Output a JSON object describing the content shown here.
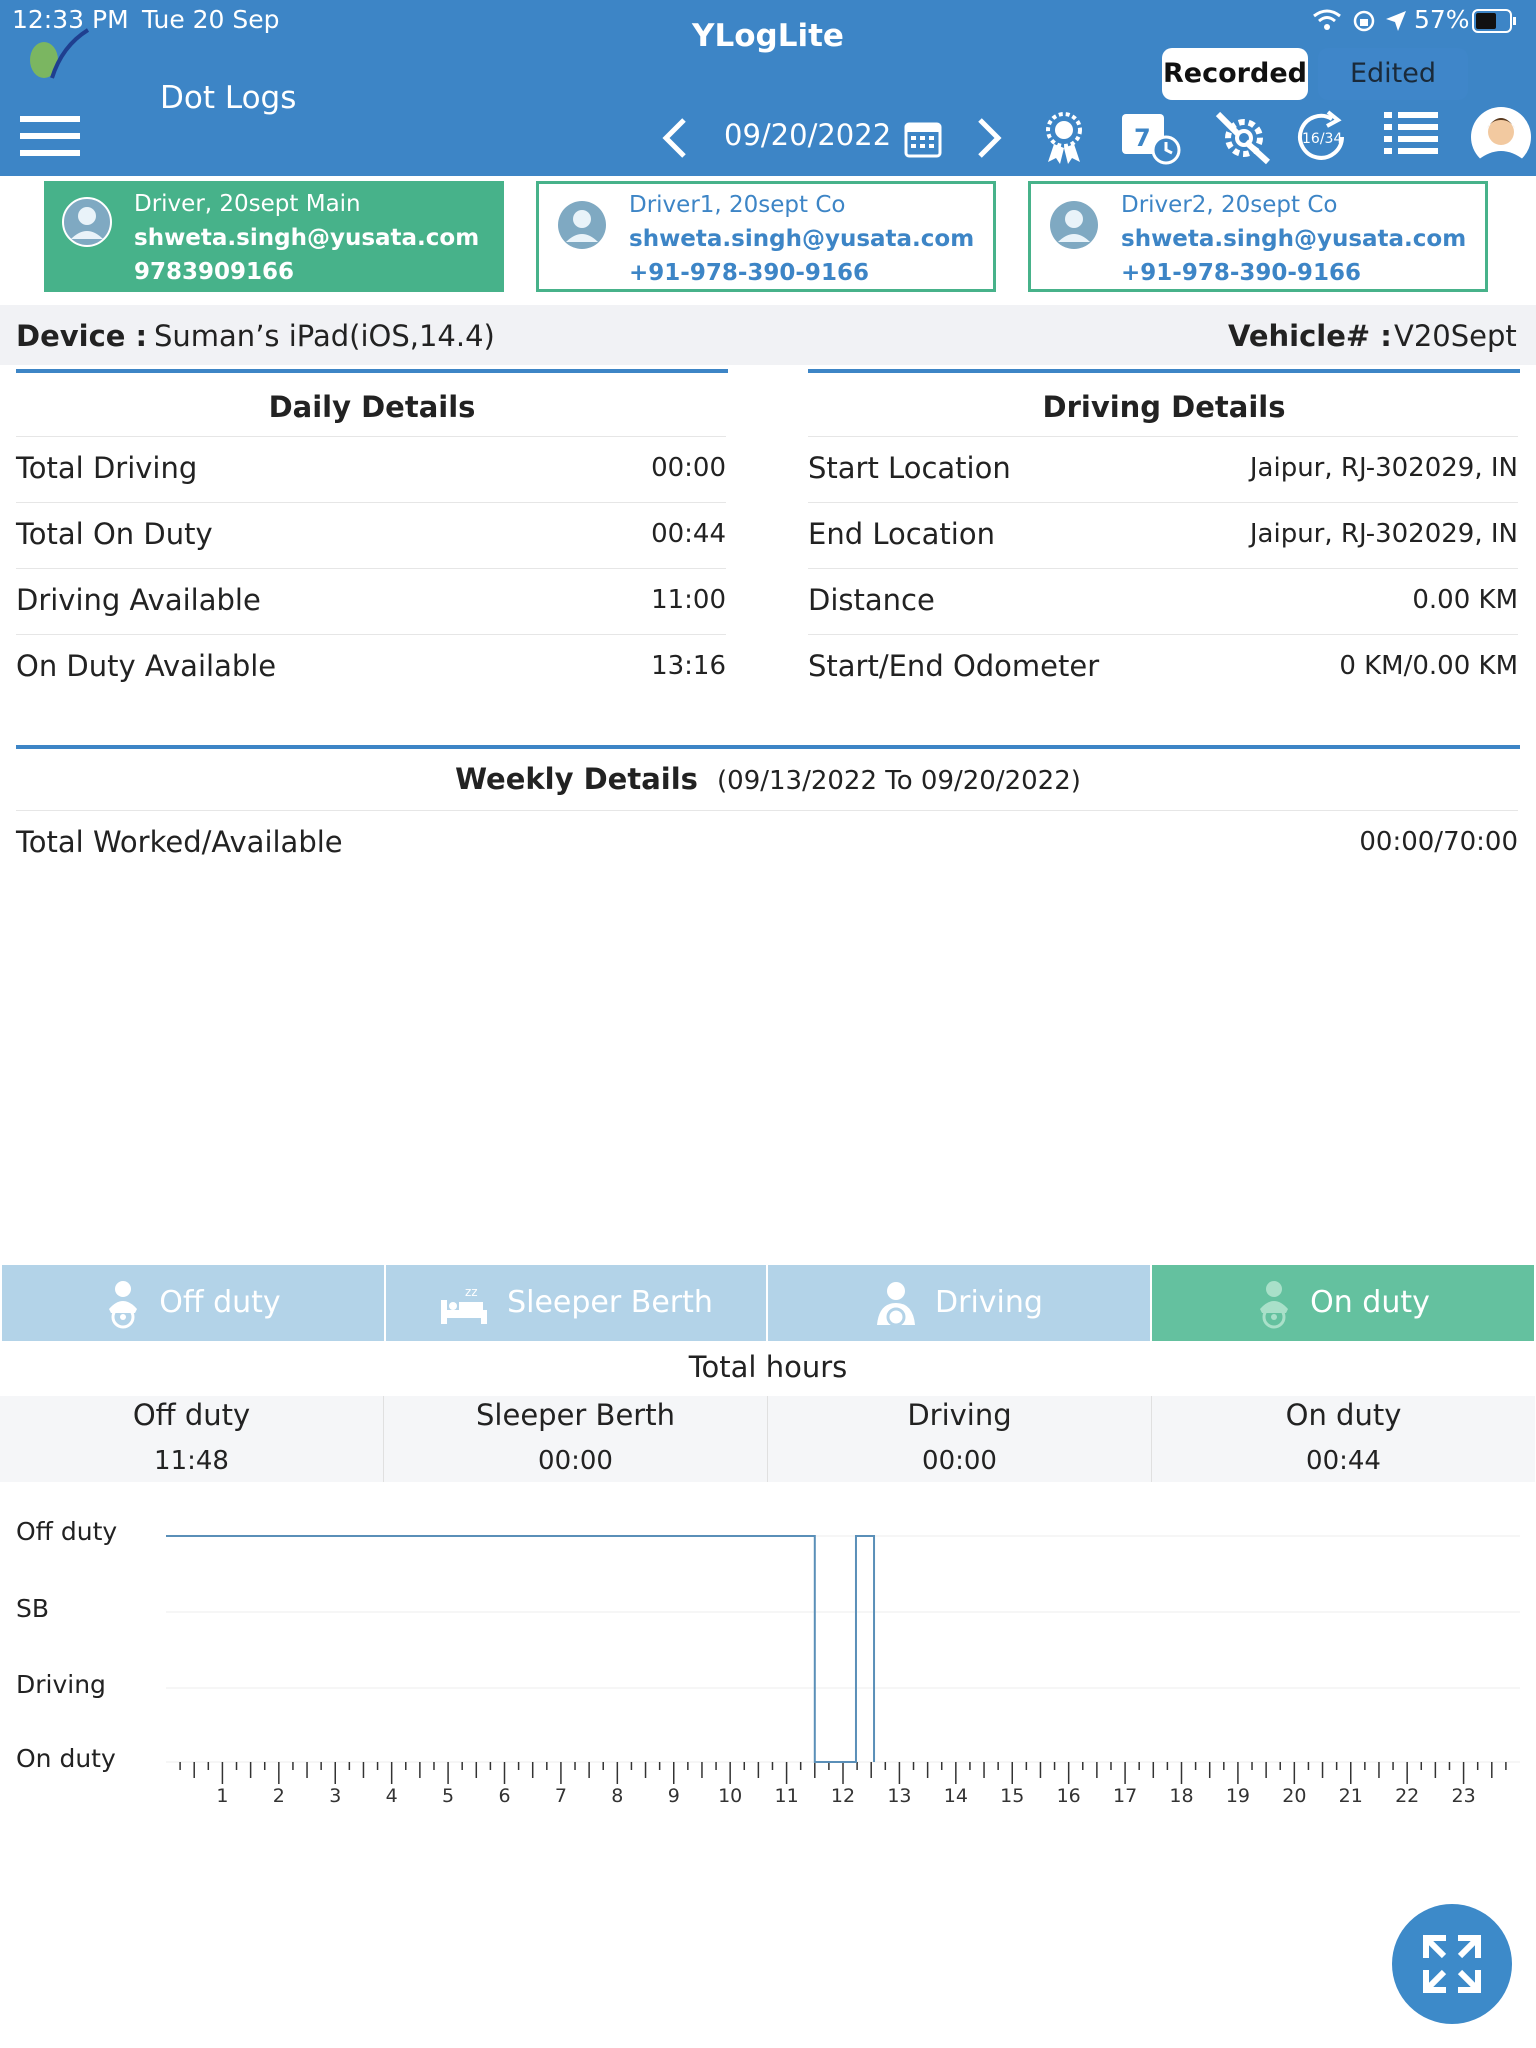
{
  "status_bar": {
    "time": "12:33 PM",
    "date": "Tue 20 Sep",
    "battery": "57%"
  },
  "header": {
    "app_title": "YLogLite",
    "screen_title": "Dot Logs",
    "segment_recorded": "Recorded",
    "segment_edited": "Edited",
    "date": "09/20/2022",
    "cycle_badge": "16/34"
  },
  "drivers": [
    {
      "name": "Driver, 20sept Main",
      "email": "shweta.singh@yusata.com",
      "phone": "9783909166"
    },
    {
      "name": "Driver1, 20sept Co",
      "email": "shweta.singh@yusata.com",
      "phone": "+91-978-390-9166"
    },
    {
      "name": "Driver2, 20sept Co",
      "email": "shweta.singh@yusata.com",
      "phone": "+91-978-390-9166"
    }
  ],
  "device": {
    "label": "Device :",
    "value": "Suman’s iPad(iOS,14.4)",
    "vehicle_label": "Vehicle# :",
    "vehicle_value": "V20Sept"
  },
  "daily_details": {
    "title": "Daily Details",
    "rows": [
      {
        "label": "Total Driving",
        "value": "00:00"
      },
      {
        "label": "Total On Duty",
        "value": "00:44"
      },
      {
        "label": "Driving Available",
        "value": "11:00"
      },
      {
        "label": "On Duty Available",
        "value": "13:16"
      }
    ]
  },
  "driving_details": {
    "title": "Driving Details",
    "rows": [
      {
        "label": "Start Location",
        "value": "Jaipur, RJ-302029, IN"
      },
      {
        "label": "End Location",
        "value": "Jaipur, RJ-302029, IN"
      },
      {
        "label": "Distance",
        "value": "0.00 KM"
      },
      {
        "label": "Start/End Odometer",
        "value": "0 KM/0.00 KM"
      }
    ]
  },
  "weekly_details": {
    "title": "Weekly Details",
    "range": "(09/13/2022 To 09/20/2022)",
    "row_label": "Total Worked/Available",
    "row_value": "00:00/70:00"
  },
  "status_tabs": [
    {
      "label": "Off duty",
      "active": false
    },
    {
      "label": "Sleeper Berth",
      "active": false
    },
    {
      "label": "Driving",
      "active": false
    },
    {
      "label": "On duty",
      "active": true
    }
  ],
  "total_hours": {
    "title": "Total hours",
    "columns": [
      {
        "label": "Off duty",
        "value": "11:48"
      },
      {
        "label": "Sleeper Berth",
        "value": "00:00"
      },
      {
        "label": "Driving",
        "value": "00:00"
      },
      {
        "label": "On duty",
        "value": "00:44"
      }
    ]
  },
  "colors": {
    "primary": "#3d85c6",
    "active_green": "#47b28a",
    "tab_inactive": "#b3d3e8"
  },
  "chart_data": {
    "type": "line",
    "step": true,
    "x_range": [
      0,
      24
    ],
    "x_ticks": [
      1,
      2,
      3,
      4,
      5,
      6,
      7,
      8,
      9,
      10,
      11,
      12,
      13,
      14,
      15,
      16,
      17,
      18,
      19,
      20,
      21,
      22,
      23
    ],
    "y_categories": [
      "Off duty",
      "SB",
      "Driving",
      "On duty"
    ],
    "segments": [
      {
        "status": "Off duty",
        "start": 0,
        "end": 11.5
      },
      {
        "status": "On duty",
        "start": 11.5,
        "end": 12.23
      },
      {
        "status": "Off duty",
        "start": 12.23,
        "end": 12.55
      },
      {
        "status": "On duty",
        "start": 12.55,
        "end": 12.55
      }
    ]
  }
}
